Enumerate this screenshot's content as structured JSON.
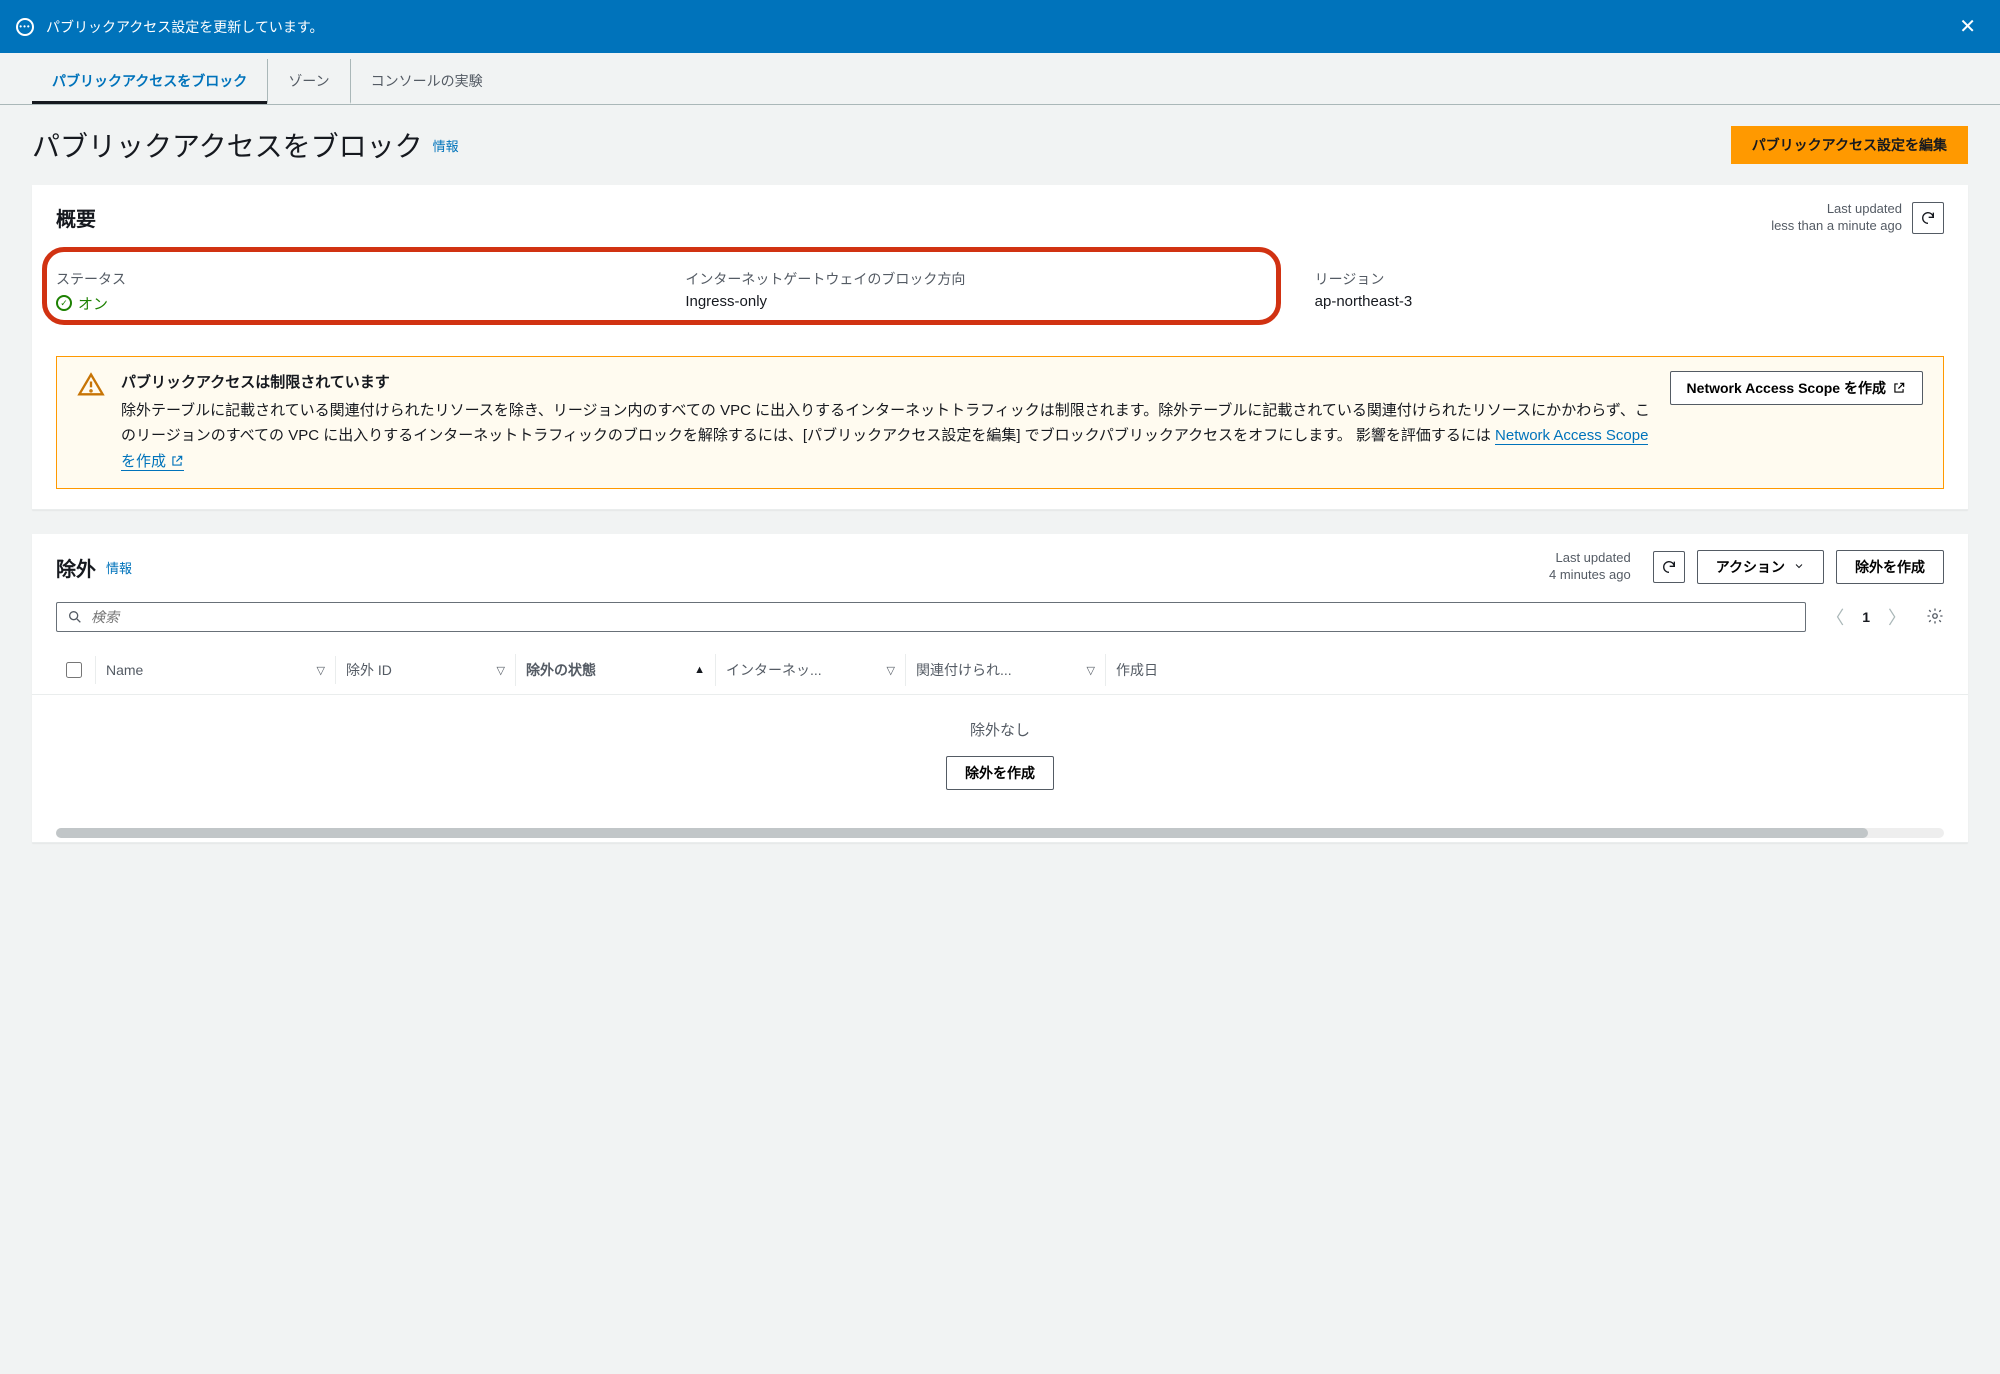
{
  "flash": {
    "message": "パブリックアクセス設定を更新しています。"
  },
  "tabs": [
    {
      "label": "パブリックアクセスをブロック",
      "active": true
    },
    {
      "label": "ゾーン"
    },
    {
      "label": "コンソールの実験"
    }
  ],
  "header": {
    "title": "パブリックアクセスをブロック",
    "info": "情報",
    "edit_btn": "パブリックアクセス設定を編集"
  },
  "summary": {
    "title": "概要",
    "last_updated_label": "Last updated",
    "last_updated_value": "less than a minute ago",
    "status_label": "ステータス",
    "status_value": "オン",
    "direction_label": "インターネットゲートウェイのブロック方向",
    "direction_value": "Ingress-only",
    "region_label": "リージョン",
    "region_value": "ap-northeast-3"
  },
  "alert": {
    "title": "パブリックアクセスは制限されています",
    "text_1": "除外テーブルに記載されている関連付けられたリソースを除き、リージョン内のすべての VPC に出入りするインターネットトラフィックは制限されます。除外テーブルに記載されている関連付けられたリソースにかかわらず、このリージョンのすべての VPC に出入りするインターネットトラフィックのブロックを解除するには、[パブリックアクセス設定を編集] でブロックパブリックアクセスをオフにします。 影響を評価するには ",
    "link": "Network Access Scope を作成",
    "btn": "Network Access Scope を作成"
  },
  "exclusions": {
    "title": "除外",
    "info": "情報",
    "last_updated_label": "Last updated",
    "last_updated_value": "4 minutes ago",
    "actions_btn": "アクション",
    "create_btn": "除外を作成",
    "search_placeholder": "検索",
    "page": "1",
    "columns": {
      "name": "Name",
      "id": "除外 ID",
      "state": "除外の状態",
      "igw": "インターネッ...",
      "assoc": "関連付けられ...",
      "date": "作成日"
    },
    "empty_text": "除外なし",
    "empty_btn": "除外を作成"
  }
}
